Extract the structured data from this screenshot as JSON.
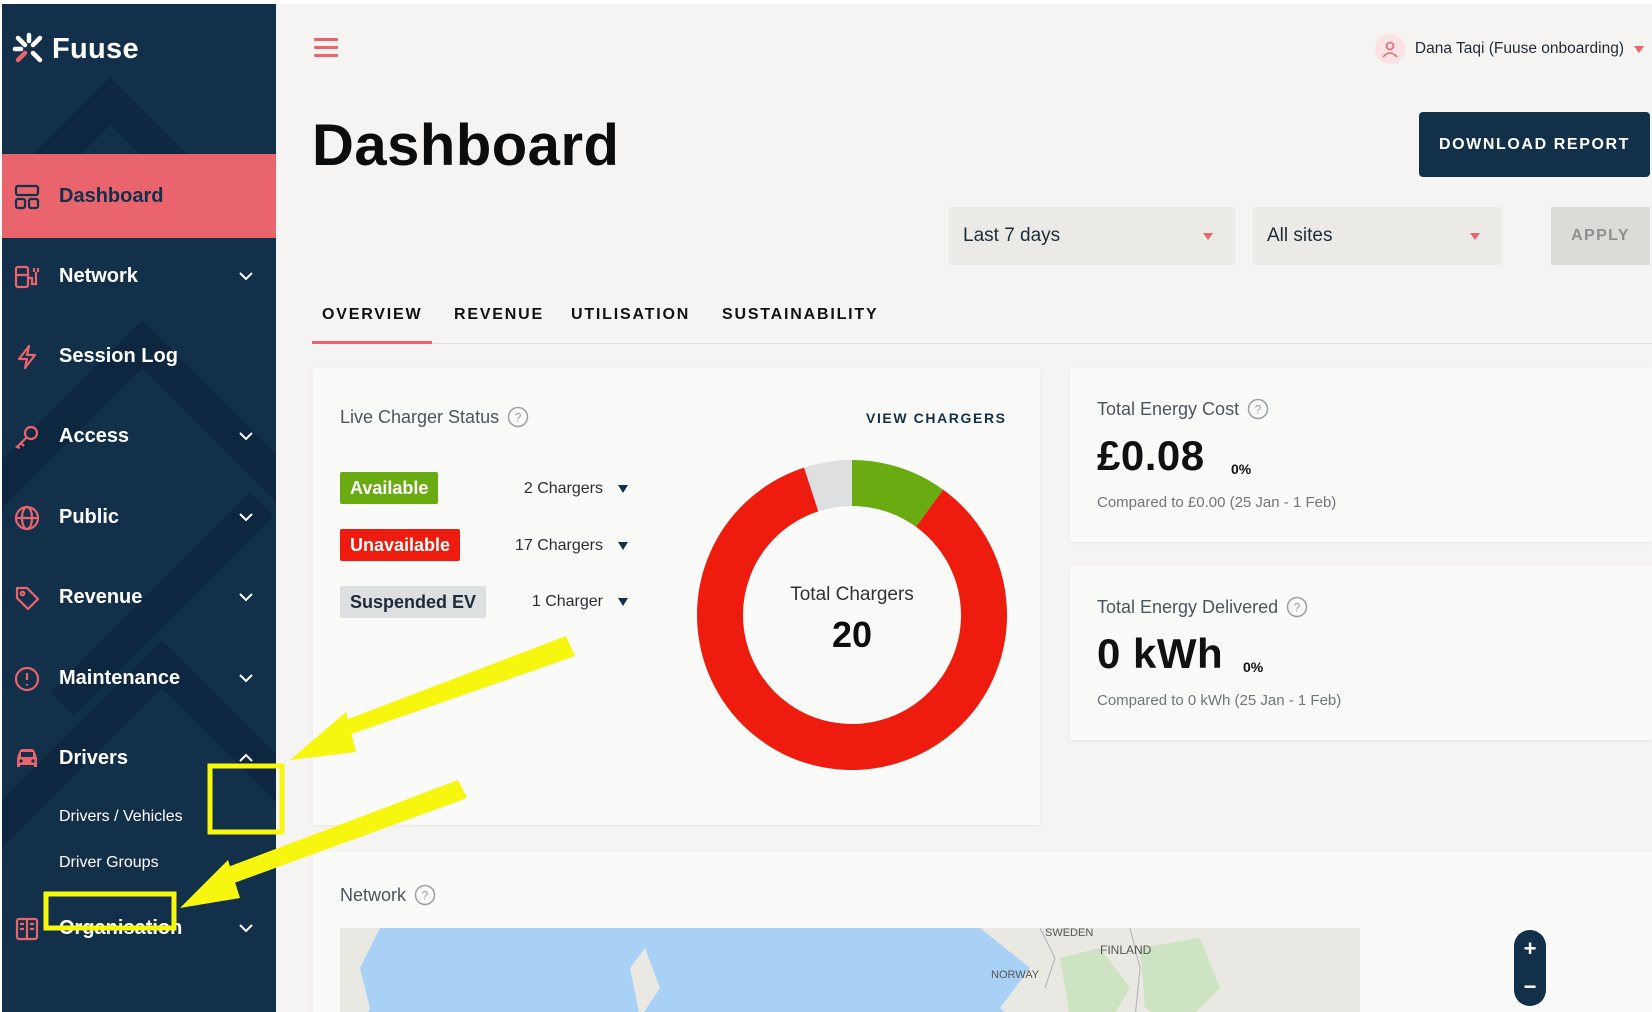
{
  "app": {
    "name": "Fuuse"
  },
  "sidebar": {
    "items": [
      {
        "label": "Dashboard"
      },
      {
        "label": "Network"
      },
      {
        "label": "Session Log"
      },
      {
        "label": "Access"
      },
      {
        "label": "Public"
      },
      {
        "label": "Revenue"
      },
      {
        "label": "Maintenance"
      },
      {
        "label": "Drivers"
      },
      {
        "label": "Organisation"
      }
    ],
    "drivers_sub": [
      {
        "label": "Drivers / Vehicles"
      },
      {
        "label": "Driver Groups"
      }
    ]
  },
  "header": {
    "user_name": "Dana Taqi (Fuuse onboarding)"
  },
  "page": {
    "title": "Dashboard",
    "download_label": "DOWNLOAD REPORT",
    "filters": {
      "period": "Last 7 days",
      "sites": "All sites",
      "apply_label": "APPLY"
    },
    "tabs": [
      {
        "label": "OVERVIEW"
      },
      {
        "label": "REVENUE"
      },
      {
        "label": "UTILISATION"
      },
      {
        "label": "SUSTAINABILITY"
      }
    ]
  },
  "live_status": {
    "title": "Live Charger Status",
    "view_link": "VIEW CHARGERS",
    "rows": [
      {
        "status": "Available",
        "count": "2 Chargers",
        "color": "#6aab12"
      },
      {
        "status": "Unavailable",
        "count": "17 Chargers",
        "color": "#ee1c0e"
      },
      {
        "status": "Suspended EV",
        "count": "1 Charger",
        "color": "#dedfe0"
      }
    ],
    "donut_label": "Total Chargers",
    "donut_total": "20",
    "donut_values": {
      "available": 2,
      "unavailable": 17,
      "suspended": 1
    }
  },
  "energy_cost": {
    "title": "Total Energy Cost",
    "value": "£0.08",
    "delta": "0%",
    "compare": "Compared to £0.00 (25 Jan - 1 Feb)"
  },
  "energy_delivered": {
    "title": "Total Energy Delivered",
    "value": "0 kWh",
    "delta": "0%",
    "compare": "Compared to 0 kWh (25 Jan - 1 Feb)"
  },
  "network": {
    "title": "Network",
    "map_labels": {
      "sweden": "SWEDEN",
      "finland": "FINLAND",
      "norway": "NORWAY"
    },
    "zoom_in": "+",
    "zoom_out": "−"
  },
  "colors": {
    "sidebar_bg": "#13304a",
    "accent": "#e9646d",
    "annotation": "#f6f60e"
  }
}
